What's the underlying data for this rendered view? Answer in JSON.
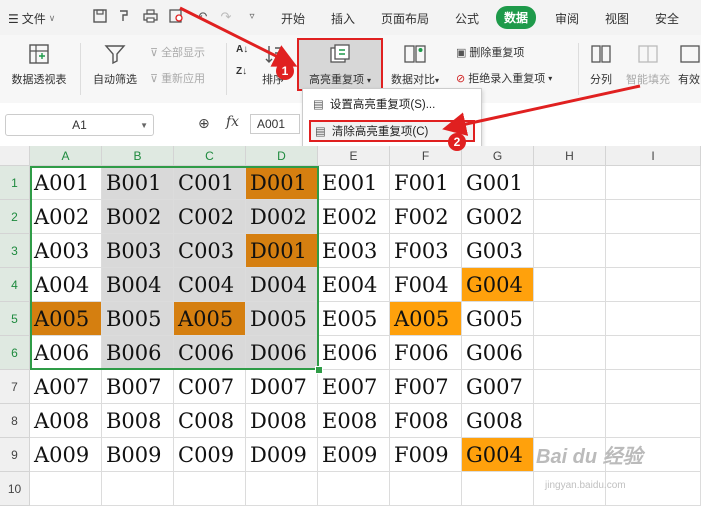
{
  "menu": {
    "file_label": "文件",
    "tabs": [
      {
        "label": "开始"
      },
      {
        "label": "插入"
      },
      {
        "label": "页面布局"
      },
      {
        "label": "公式"
      },
      {
        "label": "数据",
        "active": true
      },
      {
        "label": "审阅"
      },
      {
        "label": "视图"
      },
      {
        "label": "安全"
      }
    ]
  },
  "ribbon": {
    "pivot": "数据透视表",
    "autofilter": "自动筛选",
    "show_all": "全部显示",
    "reapply": "重新应用",
    "sort": "排序",
    "highlight_dup": "高亮重复项",
    "compare": "数据对比",
    "delete_dup": "删除重复项",
    "reject_dup": "拒绝录入重复项",
    "split": "分列",
    "smart_fill": "智能填充",
    "valid": "有效"
  },
  "dropdown": {
    "set_dup": "设置高亮重复项(S)...",
    "clear_dup": "清除高亮重复项(C)"
  },
  "formula_bar": {
    "name_box": "A1",
    "fx": "fx",
    "value": "A001"
  },
  "annotations": {
    "badge1": "1",
    "badge2": "2"
  },
  "grid": {
    "columns": [
      "A",
      "B",
      "C",
      "D",
      "E",
      "F",
      "G",
      "H",
      "I"
    ],
    "rows": [
      "1",
      "2",
      "3",
      "4",
      "5",
      "6",
      "7",
      "8",
      "9",
      "10"
    ],
    "cells": [
      [
        "A001",
        "B001",
        "C001",
        "D001",
        "E001",
        "F001",
        "G001"
      ],
      [
        "A002",
        "B002",
        "C002",
        "D002",
        "E002",
        "F002",
        "G002"
      ],
      [
        "A003",
        "B003",
        "C003",
        "D001",
        "E003",
        "F003",
        "G003"
      ],
      [
        "A004",
        "B004",
        "C004",
        "D004",
        "E004",
        "F004",
        "G004"
      ],
      [
        "A005",
        "B005",
        "A005",
        "D005",
        "E005",
        "A005",
        "G005"
      ],
      [
        "A006",
        "B006",
        "C006",
        "D006",
        "E006",
        "F006",
        "G006"
      ],
      [
        "A007",
        "B007",
        "C007",
        "D007",
        "E007",
        "F007",
        "G007"
      ],
      [
        "A008",
        "B008",
        "C008",
        "D008",
        "E008",
        "F008",
        "G008"
      ],
      [
        "A009",
        "B009",
        "C009",
        "D009",
        "E009",
        "F009",
        "G004"
      ]
    ],
    "colors": {
      "gray": "#d9d9d9",
      "dark_orange": "#d57f10",
      "orange": "#ffa10c",
      "selection": "#2f9c47"
    }
  },
  "watermark": {
    "main": "Bai du 经验",
    "sub": "jingyan.baidu.com"
  }
}
